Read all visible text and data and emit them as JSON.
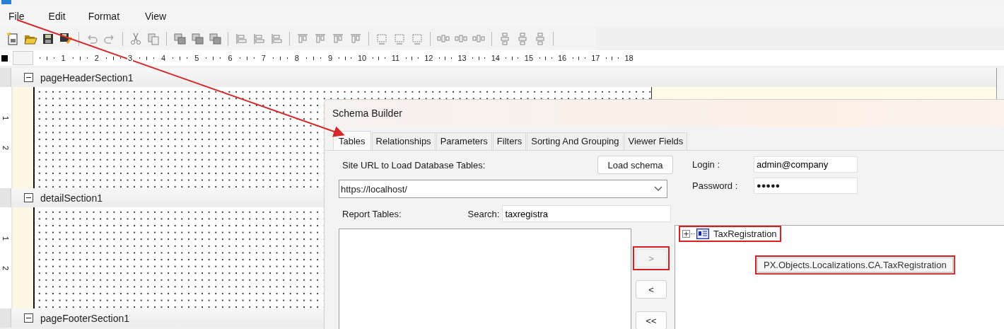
{
  "menu": [
    {
      "label": "File"
    },
    {
      "label": "Edit"
    },
    {
      "label": "Format"
    },
    {
      "label": "View"
    }
  ],
  "ruler": {
    "numbers": [
      "1",
      "2",
      "3",
      "4",
      "5",
      "6",
      "7",
      "8",
      "9",
      "10",
      "11",
      "12",
      "13",
      "14",
      "15",
      "16",
      "17",
      "18"
    ]
  },
  "sections": [
    {
      "name": "pageHeaderSection1",
      "expanded": true,
      "ruler_marks": [
        "1",
        "2"
      ]
    },
    {
      "name": "detailSection1",
      "expanded": true,
      "ruler_marks": [
        "1",
        "2"
      ]
    },
    {
      "name": "pageFooterSection1",
      "expanded": true
    }
  ],
  "dialog": {
    "title": "Schema Builder",
    "tabs": [
      {
        "label": "Tables",
        "selected": true
      },
      {
        "label": "Relationships",
        "selected": false
      },
      {
        "label": "Parameters",
        "selected": false
      },
      {
        "label": "Filters",
        "selected": false
      },
      {
        "label": "Sorting And Grouping",
        "selected": false
      },
      {
        "label": "Viewer Fields",
        "selected": false
      }
    ],
    "site_url_label": "Site URL to Load Database Tables:",
    "load_button": "Load schema",
    "url_value": "https://localhost/",
    "report_tables_label": "Report Tables:",
    "search_label": "Search:",
    "search_value": "taxregistra",
    "move_buttons": [
      {
        "label": ">",
        "disabled": true,
        "highlighted": true
      },
      {
        "label": "<",
        "disabled": false,
        "highlighted": false
      },
      {
        "label": "<<",
        "disabled": false,
        "highlighted": false
      }
    ],
    "login_label": "Login :",
    "login_value": "admin@company",
    "password_label": "Password :",
    "password_value": "●●●●●",
    "tree": [
      {
        "label": "TaxRegistration",
        "expanded": false,
        "highlighted": true
      }
    ],
    "tooltip": {
      "text": "PX.Objects.Localizations.CA.TaxRegistration",
      "highlighted": true
    }
  }
}
